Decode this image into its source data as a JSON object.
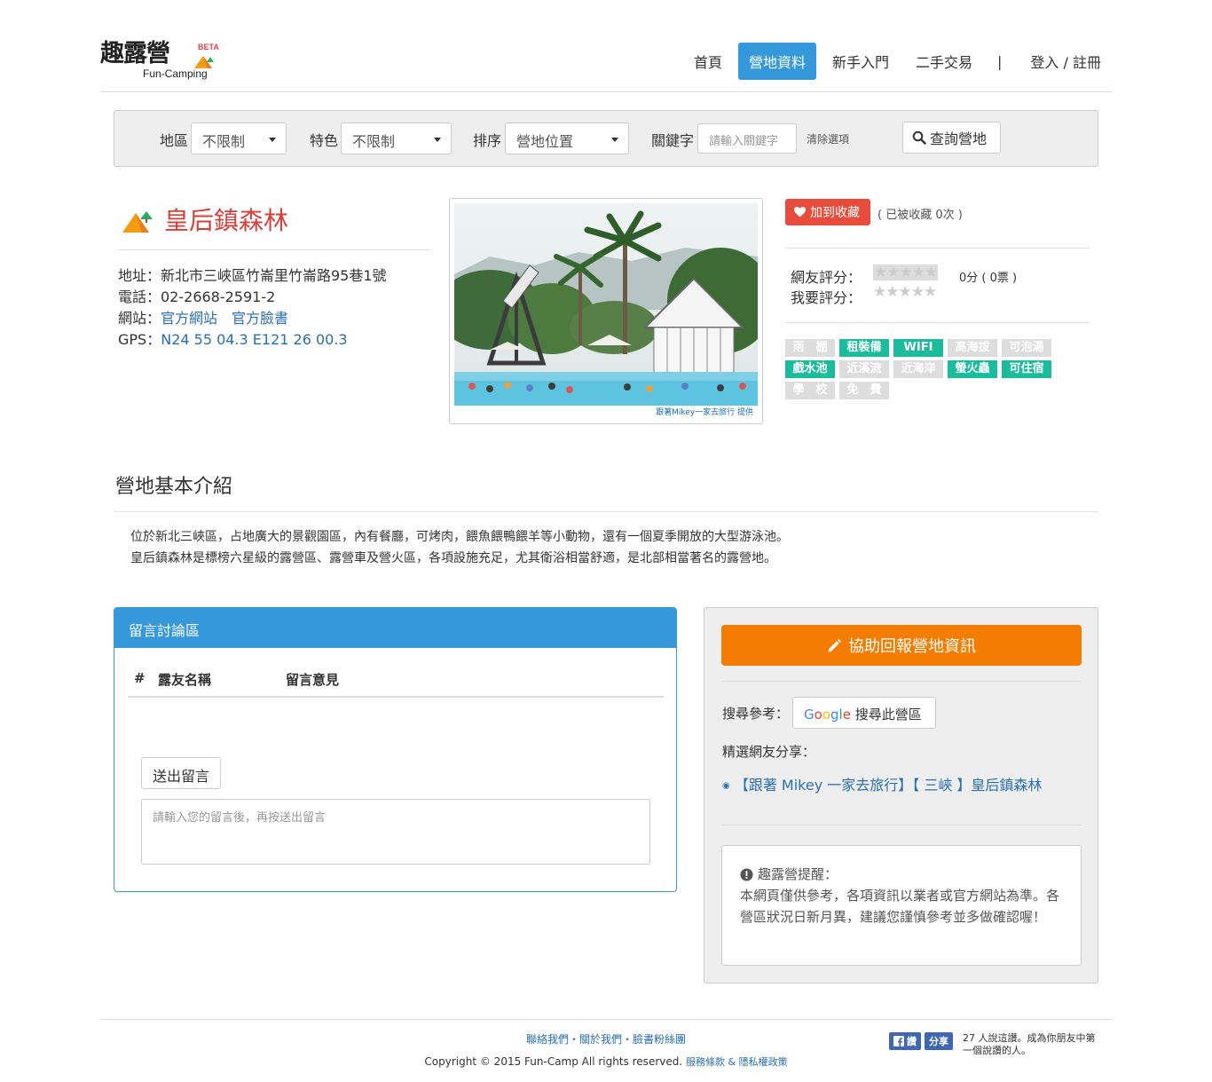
{
  "header": {
    "logo_text": "趣露營",
    "logo_sub": "Fun-Camping",
    "logo_beta": "BETA",
    "nav": [
      "首頁",
      "營地資料",
      "新手入門",
      "二手交易"
    ],
    "nav_sep": "|",
    "login": "登入 / 註冊"
  },
  "filter": {
    "region_label": "地區",
    "region_value": "不限制",
    "feature_label": "特色",
    "feature_value": "不限制",
    "sort_label": "排序",
    "sort_value": "營地位置",
    "keyword_label": "關鍵字",
    "keyword_placeholder": "請輸入關鍵字",
    "clear": "清除選項",
    "search": "查詢營地"
  },
  "site": {
    "name": "皇后鎮森林",
    "address": "地址：新北市三峽區竹崙里竹崙路95巷1號",
    "phone": "電話：02-2668-2591-2",
    "web_label": "網站：",
    "web_link1": "官方網站",
    "web_link2": "官方臉書",
    "gps_label": "GPS：",
    "gps_value": "N24 55 04.3 E121 26 00.3",
    "photo_credit": "跟著Mikey一家去旅行  提供"
  },
  "side": {
    "fav_button": "加到收藏",
    "fav_count": "( 已被收藏 0次 )",
    "user_rating_label": "網友評分：",
    "my_rating_label": "我要評分：",
    "stars": "★★★★★",
    "score": "0分 ( 0票 )",
    "tags": [
      {
        "label": "雨　棚",
        "on": false
      },
      {
        "label": "租裝備",
        "on": true
      },
      {
        "label": "WIFI",
        "on": true
      },
      {
        "label": "高海拔",
        "on": false
      },
      {
        "label": "可泡湯",
        "on": false
      },
      {
        "label": "戲水池",
        "on": true
      },
      {
        "label": "近溪流",
        "on": false
      },
      {
        "label": "近海岸",
        "on": false
      },
      {
        "label": "螢火蟲",
        "on": true
      },
      {
        "label": "可住宿",
        "on": true
      },
      {
        "label": "學　校",
        "on": false
      },
      {
        "label": "免　費",
        "on": false
      }
    ]
  },
  "intro": {
    "title": "營地基本介紹",
    "line1": "位於新北三峽區，占地廣大的景觀園區，內有餐廳，可烤肉，餵魚餵鴨餵羊等小動物，還有一個夏季開放的大型游泳池。",
    "line2": "皇后鎮森林是標榜六星級的露營區、露營車及營火區，各項設施充足，尤其衛浴相當舒適，是北部相當著名的露營地。"
  },
  "comments": {
    "title": "留言討論區",
    "col_num": "#",
    "col_name": "露友名稱",
    "col_msg": "留言意見",
    "send": "送出留言",
    "placeholder": "請輸入您的留言後，再按送出留言"
  },
  "report": {
    "button": "協助回報營地資訊",
    "search_ref": "搜尋參考：",
    "google_search": "搜尋此營區",
    "featured": "精選網友分享：",
    "share_link": "【跟著 Mikey 一家去旅行】【 三峽 】皇后鎮森林",
    "reminder_title": "趣露營提醒：",
    "reminder_text": "本網頁僅供參考，各項資訊以業者或官方網站為準。各營區狀況日新月異，建議您謹慎參考並多做確認喔！"
  },
  "footer": {
    "links": "聯絡我們・關於我們・臉書粉絲團",
    "copyright": "Copyright © 2015 Fun-Camp All rights reserved.",
    "policy": "服務條款 & 隱私權政策",
    "fb_like": "讚",
    "fb_share": "分享",
    "fb_text": "27 人說這讚。成為你朋友中第一個說讚的人。"
  },
  "colors": {
    "accent": "#3498db",
    "title_red": "#d6403a",
    "orange": "#f47c00",
    "teal": "#1abc9c",
    "fav_red": "#e74c3c"
  }
}
